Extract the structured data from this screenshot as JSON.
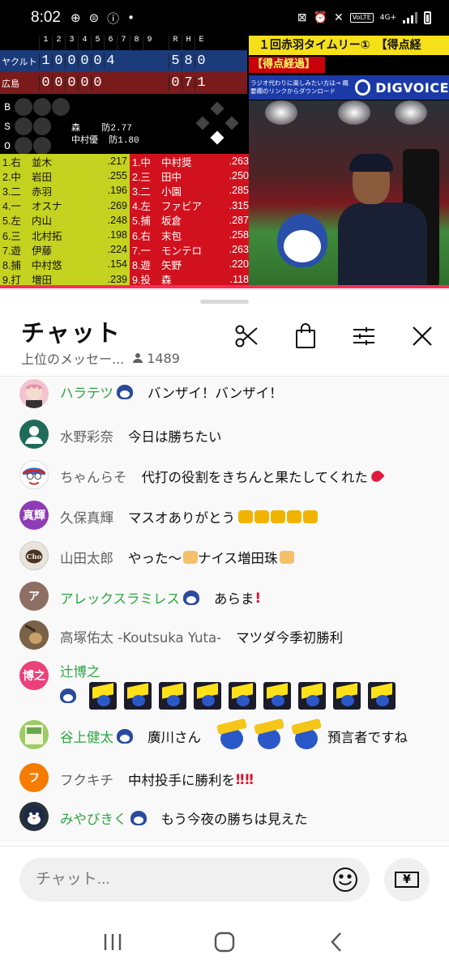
{
  "status_bar": {
    "time": "8:02",
    "network": "4G+",
    "volte": "VoLTE"
  },
  "scoreboard": {
    "innings": [
      "1",
      "2",
      "3",
      "4",
      "5",
      "6",
      "7",
      "8",
      "9",
      "R",
      "H",
      "E"
    ],
    "teams": [
      {
        "name": "ヤクルト",
        "scores": [
          "1",
          "0",
          "0",
          "0",
          "0",
          "4",
          "",
          "",
          "",
          "5",
          "8",
          "0"
        ]
      },
      {
        "name": "広島",
        "scores": [
          "0",
          "0",
          "0",
          "0",
          "0",
          "",
          "",
          "",
          "",
          "0",
          "7",
          "1"
        ]
      }
    ],
    "bso": [
      "B",
      "S",
      "O"
    ],
    "pitchers": [
      {
        "name": "森",
        "stat": "防2.77"
      },
      {
        "name": "中村優",
        "stat": "防1.80"
      }
    ],
    "lineup_left": [
      {
        "pos": "1.右",
        "name": "並木",
        "avg": ".217"
      },
      {
        "pos": "2.中",
        "name": "岩田",
        "avg": ".255"
      },
      {
        "pos": "3.二",
        "name": "赤羽",
        "avg": ".196"
      },
      {
        "pos": "4.一",
        "name": "オスナ",
        "avg": ".269"
      },
      {
        "pos": "5.左",
        "name": "内山",
        "avg": ".248"
      },
      {
        "pos": "6.三",
        "name": "北村拓",
        "avg": ".198"
      },
      {
        "pos": "7.遊",
        "name": "伊藤",
        "avg": ".224"
      },
      {
        "pos": "8.捕",
        "name": "中村悠",
        "avg": ".154"
      },
      {
        "pos": "9.打",
        "name": "増田",
        "avg": ".239"
      }
    ],
    "lineup_right": [
      {
        "pos": "1.中",
        "name": "中村奨",
        "avg": ".263"
      },
      {
        "pos": "2.三",
        "name": "田中",
        "avg": ".250"
      },
      {
        "pos": "3.二",
        "name": "小園",
        "avg": ".285"
      },
      {
        "pos": "4.左",
        "name": "ファビア",
        "avg": ".315"
      },
      {
        "pos": "5.捕",
        "name": "坂倉",
        "avg": ".287"
      },
      {
        "pos": "6.右",
        "name": "末包",
        "avg": ".258"
      },
      {
        "pos": "7.一",
        "name": "モンテロ",
        "avg": ".263"
      },
      {
        "pos": "8.遊",
        "name": "矢野",
        "avg": ".220"
      },
      {
        "pos": "9.投",
        "name": "森",
        "avg": ".118"
      }
    ]
  },
  "overlay": {
    "ticker": "１回赤羽タイムリー①　【得点経",
    "tag": "【得点経過】",
    "promo_text": "ラジオ代わりに楽しみたい方は→ 概要欄のリンクからダウンロード",
    "brand": "DIGVOICE"
  },
  "chat": {
    "title": "チャット",
    "subtitle": "上位のメッセー...",
    "viewer_count": "1489",
    "input_placeholder": "チャット...",
    "super_chat_label": "¥",
    "messages": [
      {
        "author": "ハラテツ",
        "text": "バンザイ！バンザイ！",
        "member": true,
        "avatar_color": "#f1c4cf",
        "avatar_text": ""
      },
      {
        "author": "水野彩奈",
        "text": "今日は勝ちたい",
        "member": false,
        "avatar_color": "#1f6b5a",
        "avatar_text": ""
      },
      {
        "author": "ちゃんらそ",
        "text": "代打の役割をきちんと果たしてくれた",
        "member": false,
        "avatar_color": "#2f6fd0",
        "avatar_text": ""
      },
      {
        "author": "久保真輝",
        "text": "マスオありがとう",
        "member": false,
        "avatar_color": "#8e3bb6",
        "avatar_text": "真輝"
      },
      {
        "author": "山田太郎",
        "text": "やった〜",
        "text2": "ナイス増田珠",
        "member": false,
        "avatar_color": "#5a4a3a",
        "avatar_text": ""
      },
      {
        "author": "アレックスラミレス",
        "text": "あらま",
        "member": true,
        "avatar_color": "#8d6e63",
        "avatar_text": "ア"
      },
      {
        "author": "高塚佑太 -Koutsuka Yuta-",
        "text": "マツダ今季初勝利",
        "member": false,
        "avatar_color": "#6b5640",
        "avatar_text": ""
      },
      {
        "author": "辻博之",
        "text": "",
        "member": true,
        "avatar_color": "#ec407a",
        "avatar_text": "博之"
      },
      {
        "author": "谷上健太",
        "text": "廣川さん",
        "text2": "預言者ですね",
        "member": true,
        "avatar_color": "#9ccc65",
        "avatar_text": ""
      },
      {
        "author": "フクキチ",
        "text": "中村投手に勝利を",
        "member": false,
        "avatar_color": "#f57c00",
        "avatar_text": "フ"
      },
      {
        "author": "みやびきく",
        "text": "もう今夜の勝ちは見えた",
        "member": true,
        "avatar_color": "#263238",
        "avatar_text": ""
      }
    ]
  }
}
